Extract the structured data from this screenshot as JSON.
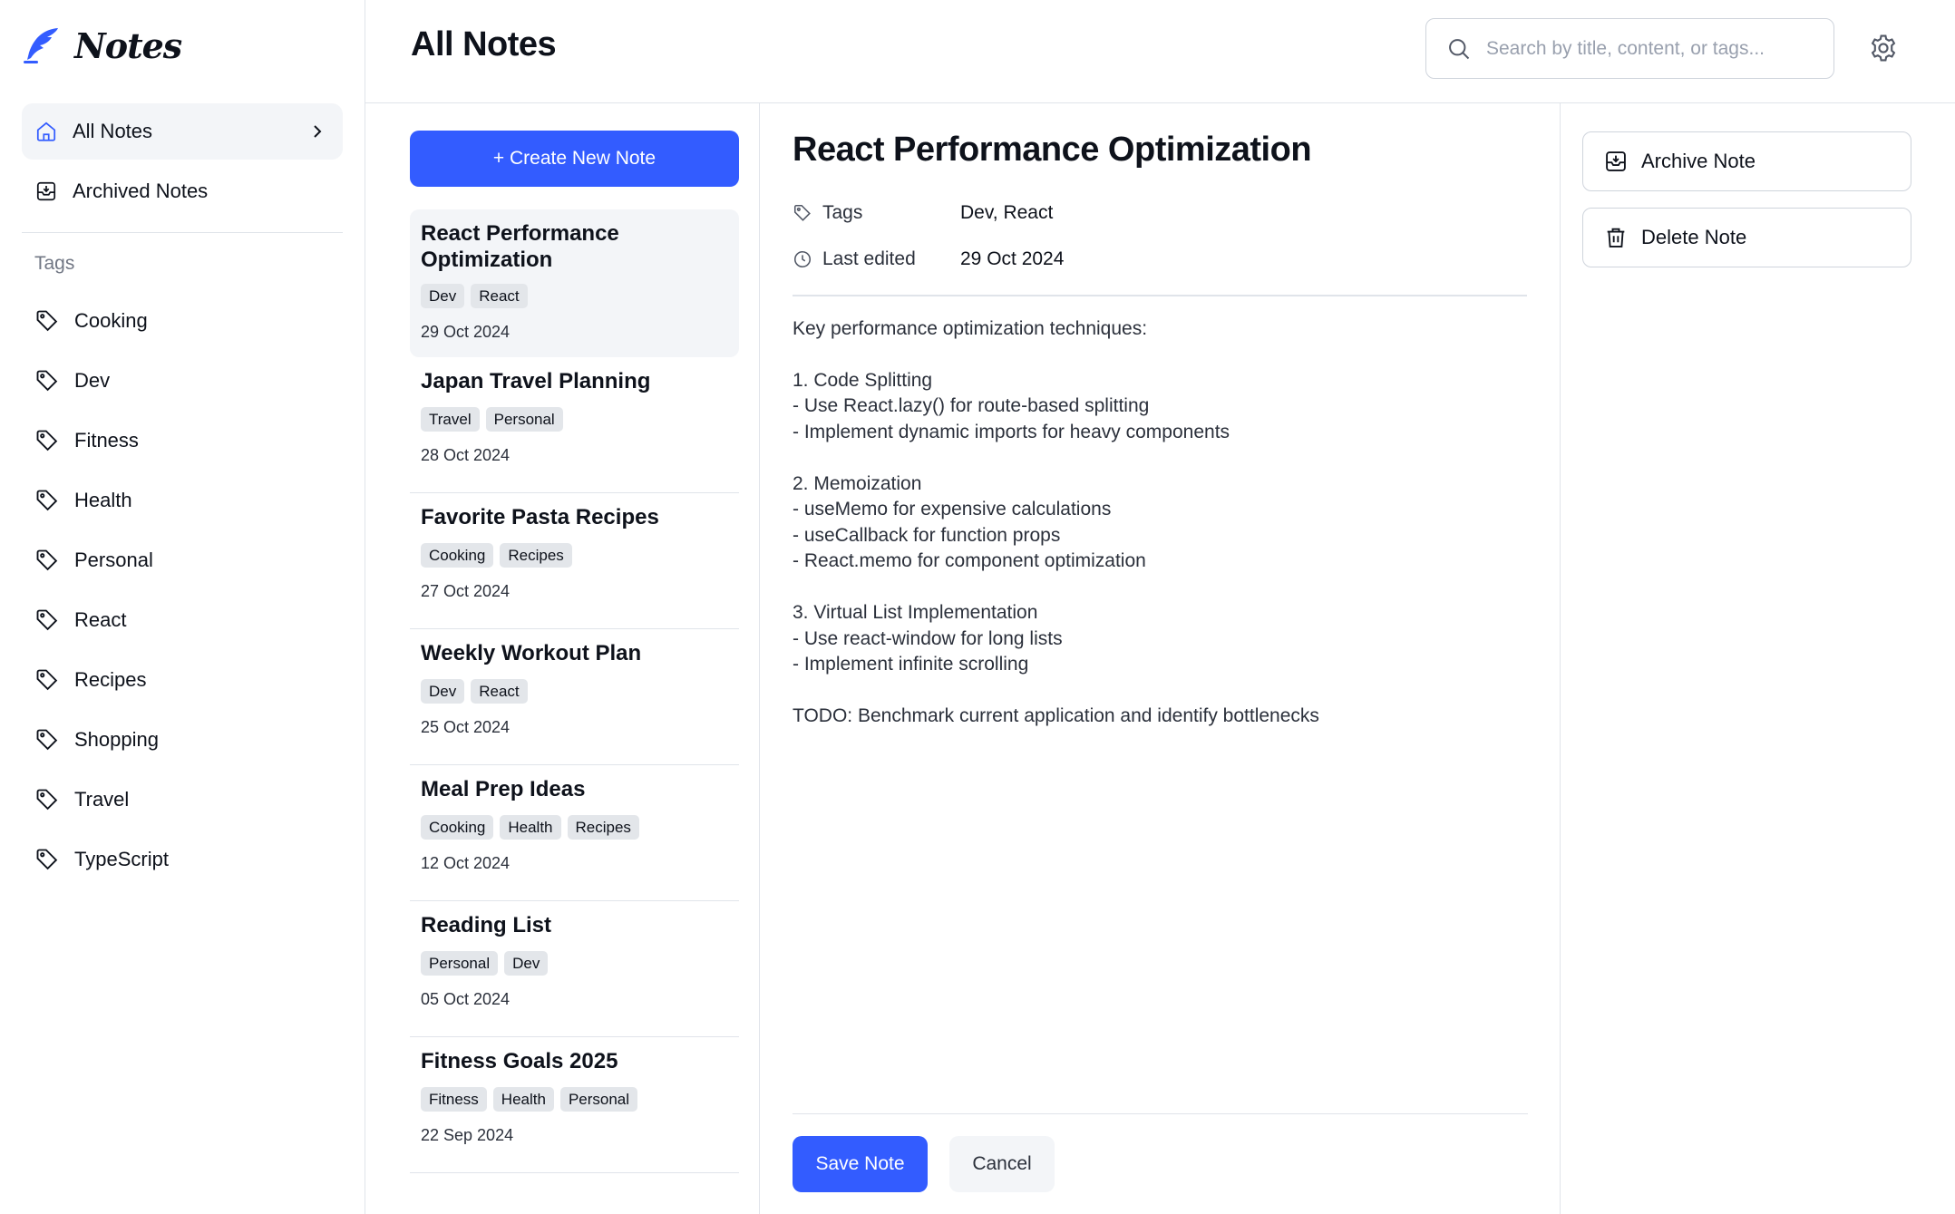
{
  "app": {
    "name": "Notes"
  },
  "colors": {
    "accent": "#335cff",
    "sidebar_active": "#f3f5f8",
    "chip_bg": "#e3e6ea"
  },
  "sidebar": {
    "nav": [
      {
        "label": "All Notes",
        "icon": "home-icon",
        "active": true
      },
      {
        "label": "Archived Notes",
        "icon": "archive-icon",
        "active": false
      }
    ],
    "tags_heading": "Tags",
    "tags": [
      "Cooking",
      "Dev",
      "Fitness",
      "Health",
      "Personal",
      "React",
      "Recipes",
      "Shopping",
      "Travel",
      "TypeScript"
    ]
  },
  "header": {
    "title": "All Notes",
    "search_placeholder": "Search by title, content, or tags..."
  },
  "list": {
    "create_label": "+ Create New Note",
    "notes": [
      {
        "title": "React Performance Optimization",
        "tags": [
          "Dev",
          "React"
        ],
        "date": "29 Oct 2024"
      },
      {
        "title": "Japan Travel Planning",
        "tags": [
          "Travel",
          "Personal"
        ],
        "date": "28 Oct 2024"
      },
      {
        "title": "Favorite Pasta Recipes",
        "tags": [
          "Cooking",
          "Recipes"
        ],
        "date": "27 Oct 2024"
      },
      {
        "title": "Weekly Workout Plan",
        "tags": [
          "Dev",
          "React"
        ],
        "date": "25 Oct 2024"
      },
      {
        "title": "Meal Prep Ideas",
        "tags": [
          "Cooking",
          "Health",
          "Recipes"
        ],
        "date": "12 Oct 2024"
      },
      {
        "title": "Reading List",
        "tags": [
          "Personal",
          "Dev"
        ],
        "date": "05 Oct 2024"
      },
      {
        "title": "Fitness Goals 2025",
        "tags": [
          "Fitness",
          "Health",
          "Personal"
        ],
        "date": "22 Sep 2024"
      }
    ]
  },
  "editor": {
    "title": "React Performance Optimization",
    "tags_label": "Tags",
    "tags_value": "Dev, React",
    "edited_label": "Last edited",
    "edited_value": "29 Oct 2024",
    "content": [
      [
        "Key performance optimization techniques:"
      ],
      [
        "1. Code Splitting",
        "- Use React.lazy() for route-based splitting",
        "- Implement dynamic imports for heavy components"
      ],
      [
        "2. Memoization",
        "- useMemo for expensive calculations",
        "- useCallback for function props",
        "- React.memo for component optimization"
      ],
      [
        "3. Virtual List Implementation",
        "- Use react-window for long lists",
        "- Implement infinite scrolling"
      ],
      [
        "TODO: Benchmark current application and identify bottlenecks"
      ]
    ],
    "save_label": "Save Note",
    "cancel_label": "Cancel"
  },
  "actions": {
    "archive_label": "Archive Note",
    "delete_label": "Delete Note"
  }
}
